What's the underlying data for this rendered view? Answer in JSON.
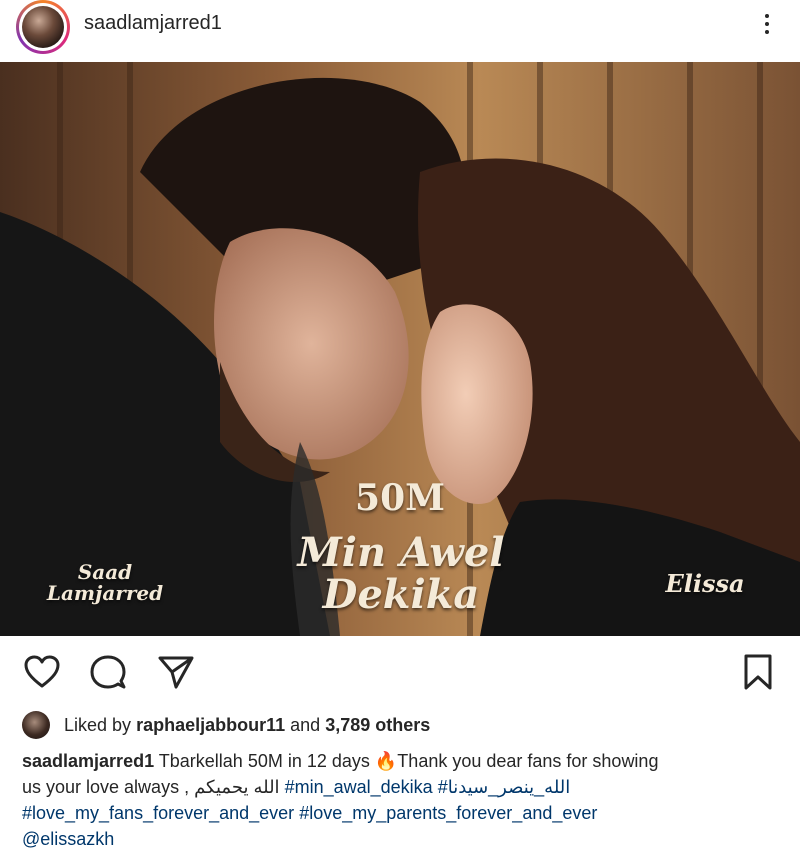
{
  "post": {
    "username": "saadlamjarred1",
    "overlay": {
      "views": "50M",
      "title_line1": "Min Awel",
      "title_line2": "Dekika",
      "artist_left_line1": "Saad",
      "artist_left_line2": "Lamjarred",
      "artist_right": "Elissa"
    },
    "likes": {
      "prefix": "Liked by",
      "liker": "raphaeljabbour11",
      "joiner": "and",
      "others": "3,789 others"
    },
    "caption": {
      "author": "saadlamjarred1",
      "line1_text": "Tbarkellah 50M in 12 days 🔥Thank you dear fans for showing",
      "line2_text": "us your love always , الله يحميكم",
      "tag_min_awal": "#min_awal_dekika",
      "tag_arabic": "#الله_ينصر_سيدنا",
      "tag_love_fans": "#love_my_fans_forever_and_ever",
      "tag_love_parents": "#love_my_parents_forever_and_ever",
      "mention": "@elissazkh"
    }
  },
  "icons": {
    "more": "more-vertical-icon",
    "like": "heart-icon",
    "comment": "comment-icon",
    "share": "send-icon",
    "save": "bookmark-icon"
  },
  "colors": {
    "text": "#262626",
    "link": "#00376b",
    "background": "#ffffff"
  }
}
